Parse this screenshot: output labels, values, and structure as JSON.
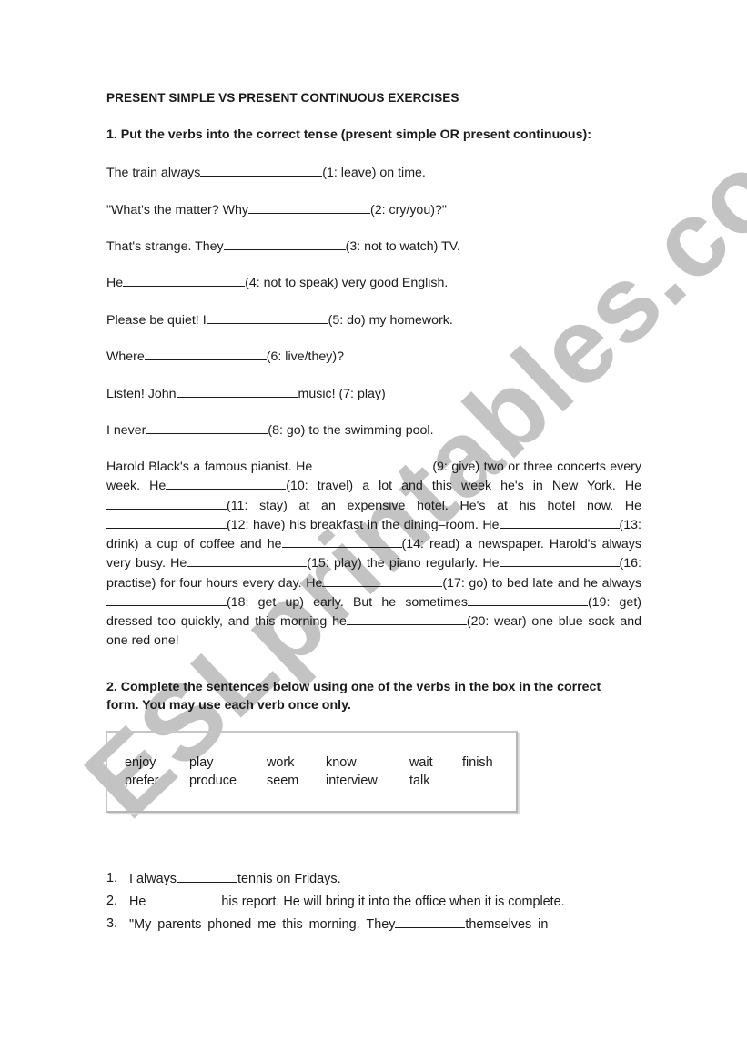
{
  "watermark": {
    "text": "ESLprintables.com",
    "color": "#b9b9b9"
  },
  "title": "PRESENT SIMPLE VS PRESENT CONTINUOUS EXERCISES",
  "exercise1": {
    "instruction": "1. Put the verbs into the correct tense (present simple OR present continuous):",
    "sentences": [
      {
        "before": "The train always",
        "after": "(1: leave) on time."
      },
      {
        "before": "\"What's the matter? Why",
        "after": "(2: cry/you)?\""
      },
      {
        "before": "That's strange. They",
        "after": "(3: not to watch) TV."
      },
      {
        "before": "He",
        "after": "(4: not to speak) very good English."
      },
      {
        "before": "Please be quiet! I",
        "after": "(5: do) my homework."
      },
      {
        "before": "Where",
        "after": "(6: live/they)?"
      },
      {
        "before": "Listen! John",
        "after": "music! (7: play)"
      },
      {
        "before": "I never",
        "after": "(8: go) to the swimming pool."
      }
    ],
    "paragraph": [
      "Harold Black's a famous  pianist. He",
      "(9: give) two or three concerts every week. He",
      "(10: travel) a lot and this week he's in New York. He",
      "(11: stay) at an expensive hotel. He's at his hotel now. He",
      "(12: have) his breakfast in the dining–room. He",
      "(13: drink) a cup of coffee and he",
      "(14: read) a newspaper. Harold's always very  busy. He",
      "(15: play) the piano regularly. He",
      "(16: practise) for four hours every day. He",
      "(17: go) to bed late and he always",
      "(18: get up) early. But  he sometimes",
      "(19: get) dressed too quickly, and this morning he",
      "(20: wear) one blue sock and one red one!"
    ]
  },
  "exercise2": {
    "instruction": "2.  Complete the sentences below using one of the verbs in the box in the correct form. You may use each verb once only.",
    "verb_box": {
      "row1": [
        "enjoy",
        "play",
        "work",
        "know",
        "wait",
        "finish"
      ],
      "row2": [
        "prefer",
        "produce",
        "seem",
        "interview",
        "talk",
        ""
      ]
    },
    "items": [
      {
        "num": "1.",
        "before": "I always",
        "after": "tennis on Fridays."
      },
      {
        "num": "2.",
        "before": "He ",
        "after": "   his report. He will bring it into the office when it is complete."
      },
      {
        "num": "3.",
        "before": "\"My parents phoned me this morning. They",
        "after": "themselves in"
      }
    ]
  }
}
